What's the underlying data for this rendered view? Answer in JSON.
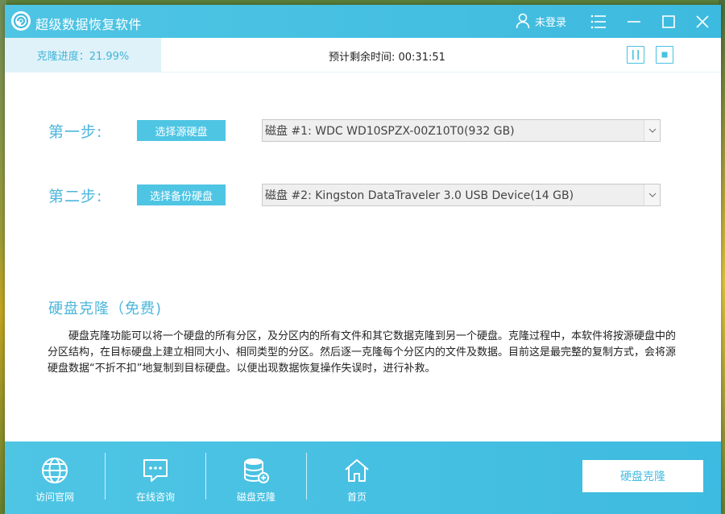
{
  "titlebar": {
    "app_title": "超级数据恢复软件",
    "user_label": "未登录"
  },
  "progress": {
    "label": "克隆进度：21.99%",
    "value_percent": 21.99,
    "eta": "预计剩余时间:  00:31:51"
  },
  "steps": [
    {
      "label": "第一步:",
      "button": "选择源硬盘",
      "selected": "磁盘 #1: WDC WD10SPZX-00Z10T0(932 GB)"
    },
    {
      "label": "第二步:",
      "button": "选择备份硬盘",
      "selected": "磁盘 #2: Kingston DataTraveler 3.0 USB Device(14 GB)"
    }
  ],
  "section": {
    "title": "硬盘克隆（免费)",
    "description": "硬盘克隆功能可以将一个硬盘的所有分区，及分区内的所有文件和其它数据克隆到另一个硬盘。克隆过程中，本软件将按源硬盘中的分区结构，在目标硬盘上建立相同大小、相同类型的分区。然后逐一克隆每个分区内的文件及数据。目前这是最完整的复制方式，会将源硬盘数据“不折不扣”地复制到目标硬盘。以便出现数据恢复操作失误时，进行补救。"
  },
  "nav": [
    {
      "label": "访问官网",
      "icon": "globe-icon"
    },
    {
      "label": "在线咨询",
      "icon": "chat-icon"
    },
    {
      "label": "磁盘克隆",
      "icon": "database-icon"
    },
    {
      "label": "首页",
      "icon": "home-icon"
    }
  ],
  "action": {
    "clone_button": "硬盘克隆"
  },
  "colors": {
    "accent": "#4fc5e4",
    "accent_dark": "#3dbadf",
    "progress_bg": "#dff2f9",
    "label_text": "#4cb6dc"
  }
}
